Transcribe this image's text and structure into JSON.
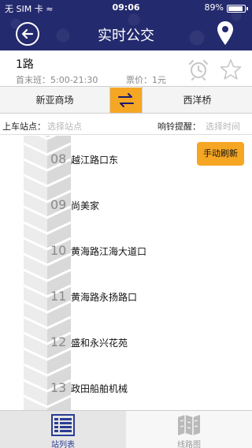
{
  "status_bar": {
    "carrier": "无 SIM 卡 ≈",
    "time": "09:06",
    "battery": "89%"
  },
  "header": {
    "title": "实时公交"
  },
  "route": {
    "name": "1路",
    "first_last": "首末班：5:00-21:30",
    "fare": "票价：1元"
  },
  "direction": {
    "start": "新亚商场",
    "end": "西洋桥"
  },
  "selectors": {
    "board_label": "上车站点：",
    "board_placeholder": "选择站点",
    "alarm_label": "响铃提醒：",
    "alarm_placeholder": "选择时间"
  },
  "refresh_label": "手动刷新",
  "stations": [
    {
      "num": "08",
      "name": "越江路口东"
    },
    {
      "num": "09",
      "name": "尚美家"
    },
    {
      "num": "10",
      "name": "黄海路江海大道口"
    },
    {
      "num": "11",
      "name": "黄海路永扬路口"
    },
    {
      "num": "12",
      "name": "盛和永兴花苑"
    },
    {
      "num": "13",
      "name": "政田船舶机械"
    }
  ],
  "tabs": {
    "stations": "站列表",
    "map": "线路图"
  },
  "colors": {
    "header": "#242a6e",
    "accent": "#f5a623",
    "active_tab": "#2b3d92"
  },
  "icons": [
    "back-icon",
    "location-pin-icon",
    "alarm-clock-icon",
    "star-icon",
    "swap-icon",
    "list-icon",
    "map-icon"
  ]
}
